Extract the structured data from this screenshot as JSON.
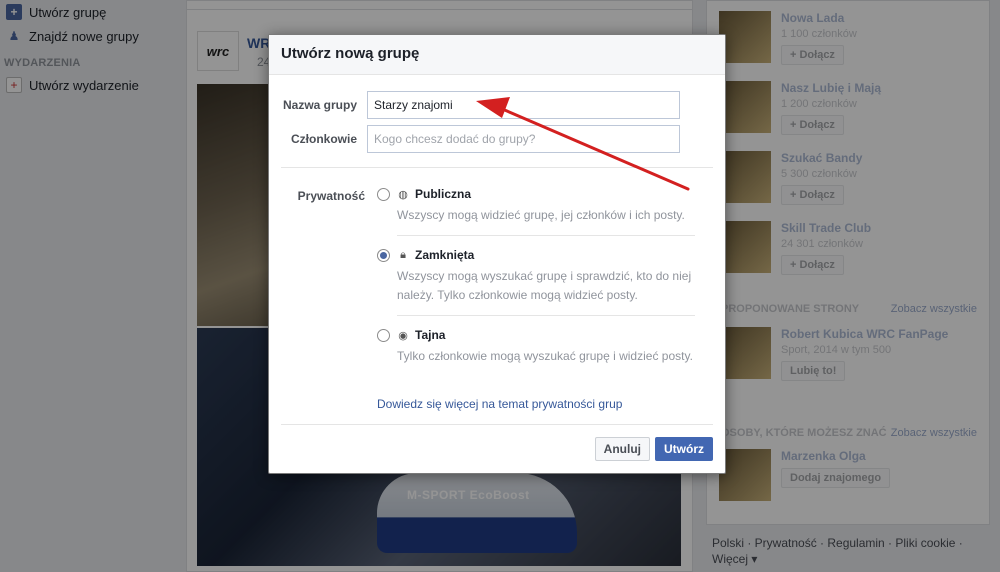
{
  "sidebar": {
    "create_group": "Utwórz grupę",
    "find_groups": "Znajdź nowe grupy",
    "events_header": "WYDARZENIA",
    "create_event": "Utwórz wydarzenie"
  },
  "feed": {
    "post_name": "WR",
    "post_date": "24 l",
    "logo_text": "wrc",
    "car_text": "M-SPORT   EcoBoost"
  },
  "right": {
    "suggestions": [
      {
        "name": "Nowa Lada",
        "sub": "1 100 członków",
        "button": "+ Dołącz"
      },
      {
        "name": "Nasz Lubię i Mają",
        "sub": "1 200 członków",
        "button": "+ Dołącz"
      },
      {
        "name": "Szukać Bandy",
        "sub": "5 300 członków",
        "button": "+ Dołącz"
      },
      {
        "name": "Skill Trade Club",
        "sub": "24 301 członków",
        "button": "+ Dołącz"
      }
    ],
    "pages_header": "PROPONOWANE STRONY",
    "see_all_1": "Zobacz wszystkie",
    "page": {
      "name": "Robert Kubica WRC FanPage",
      "sub": "Sport, 2014 w tym 500",
      "button": "Lubię to!"
    },
    "people_header": "OSOBY, KTÓRE MOŻESZ ZNAĆ",
    "see_all_2": "Zobacz wszystkie",
    "person": {
      "name": "Marzenka Olga",
      "button": "Dodaj znajomego"
    }
  },
  "footer": {
    "line1": "Polski · Prywatność · Regulamin · Pliki cookie ·",
    "line2": "Więcej ▾"
  },
  "dialog": {
    "title": "Utwórz nową grupę",
    "name_label": "Nazwa grupy",
    "name_value": "Starzy znajomi",
    "members_label": "Członkowie",
    "members_placeholder": "Kogo chcesz dodać do grupy?",
    "privacy_label": "Prywatność",
    "options": [
      {
        "title": "Publiczna",
        "desc": "Wszyscy mogą widzieć grupę, jej członków i ich posty.",
        "selected": false,
        "icon": "globe-icon"
      },
      {
        "title": "Zamknięta",
        "desc": "Wszyscy mogą wyszukać grupę i sprawdzić, kto do niej należy. Tylko członkowie mogą widzieć posty.",
        "selected": true,
        "icon": "lock-icon"
      },
      {
        "title": "Tajna",
        "desc": "Tylko członkowie mogą wyszukać grupę i widzieć posty.",
        "selected": false,
        "icon": "secret-icon"
      }
    ],
    "learn_more": "Dowiedz się więcej na temat prywatności grup",
    "cancel": "Anuluj",
    "create": "Utwórz"
  },
  "colors": {
    "accent": "#4267b2",
    "arrow": "#d32020"
  }
}
